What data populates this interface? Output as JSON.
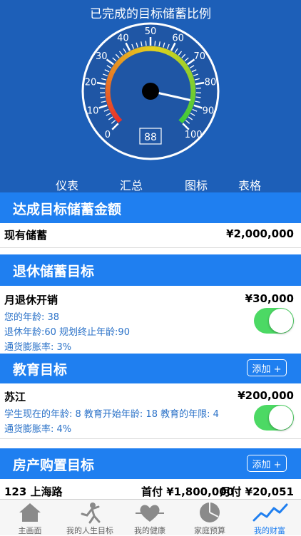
{
  "gauge": {
    "title": "已完成的目标储蓄比例",
    "value": 88,
    "ticks": [
      "0",
      "10",
      "20",
      "30",
      "40",
      "50",
      "60",
      "70",
      "80",
      "90",
      "100"
    ],
    "needle_value": 88,
    "colors": {
      "red": "#e8332a",
      "yellow": "#e5d21e",
      "green": "#38c93a",
      "face": "#1f56a5",
      "rim": "#ffffff"
    }
  },
  "view_tabs": [
    "仪表",
    "汇总",
    "图标",
    "表格"
  ],
  "sections": {
    "target_savings": {
      "title": "达成目标储蓄金额"
    },
    "current_savings": {
      "label": "现有储蓄",
      "amount": "¥2,000,000"
    },
    "retirement": {
      "title": "退休储蓄目标",
      "label": "月退休开销",
      "amount": "¥30,000",
      "details": [
        "您的年龄: 38",
        "退休年龄:60 规划终止年龄:90",
        "通货膨胀率: 3%"
      ],
      "enabled": true
    },
    "education": {
      "title": "教育目标",
      "add_label": "添加 +",
      "label": "苏江",
      "amount": "¥200,000",
      "details": [
        "学生现在的年龄: 8 教育开始年龄: 18 教育的年限: 4",
        "通货膨胀率: 4%"
      ],
      "enabled": true
    },
    "housing": {
      "title": "房产购置目标",
      "add_label": "添加 +",
      "row_text": "123 上海路",
      "down_payment": "首付 ¥1,800,000",
      "monthly": "月付 ¥20,051"
    }
  },
  "tabbar": [
    {
      "label": "主画面",
      "icon": "home-icon",
      "active": false
    },
    {
      "label": "我的人生目标",
      "icon": "person-goals-icon",
      "active": false
    },
    {
      "label": "我的健康",
      "icon": "heart-pulse-icon",
      "active": false
    },
    {
      "label": "家庭预算",
      "icon": "pie-chart-icon",
      "active": false
    },
    {
      "label": "我的财富",
      "icon": "trend-line-icon",
      "active": true
    }
  ]
}
